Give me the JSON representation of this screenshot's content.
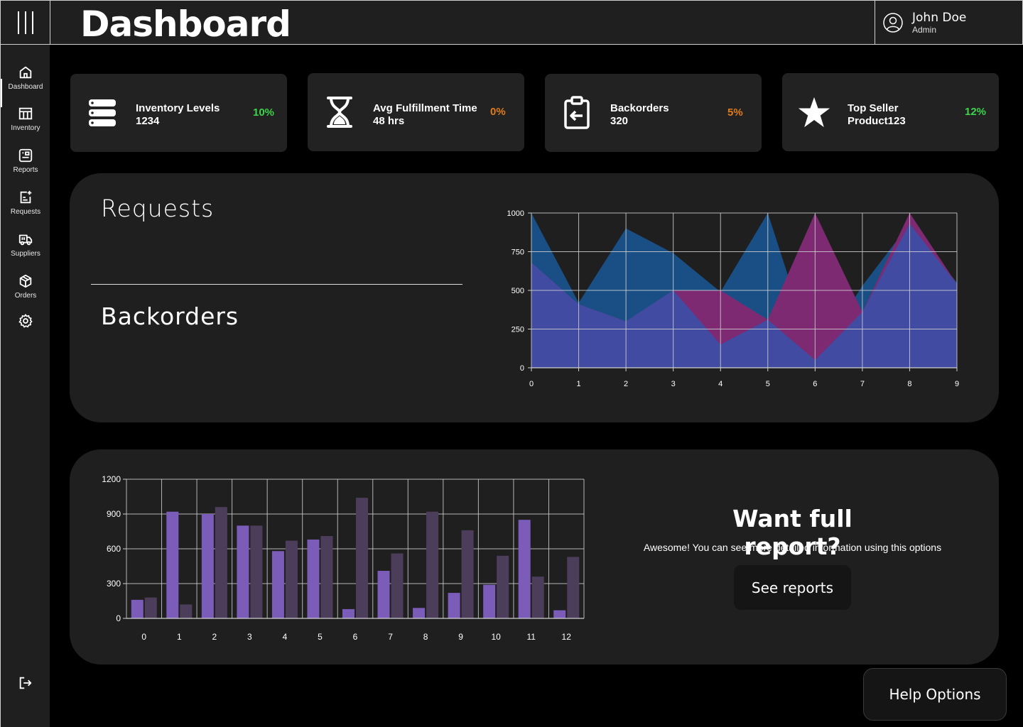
{
  "header": {
    "title": "Dashboard",
    "user_name": "John Doe",
    "user_role": "Admin"
  },
  "sidebar": {
    "items": [
      {
        "label": "Dashboard",
        "icon": "home-icon"
      },
      {
        "label": "Inventory",
        "icon": "table-icon"
      },
      {
        "label": "Reports",
        "icon": "report-icon"
      },
      {
        "label": "Requests",
        "icon": "request-icon"
      },
      {
        "label": "Suppliers",
        "icon": "truck-icon"
      },
      {
        "label": "Orders",
        "icon": "box-icon"
      }
    ],
    "settings_icon": "gear-icon",
    "logout_icon": "logout-icon"
  },
  "kpis": [
    {
      "label": "Inventory Levels",
      "value": "1234",
      "change": "10%",
      "color": "#3bd44a",
      "icon": "server-icon"
    },
    {
      "label": "Avg Fulfillment Time",
      "value": "48 hrs",
      "change": "0%",
      "color": "#e07b1a",
      "icon": "hourglass-icon"
    },
    {
      "label": "Backorders",
      "value": "320",
      "change": "5%",
      "color": "#e07b1a",
      "icon": "clipboard-icon"
    },
    {
      "label": "Top Seller",
      "value": "Product123",
      "change": "12%",
      "color": "#3bd44a",
      "icon": "star-icon"
    }
  ],
  "panels": {
    "requests_title": "Requests",
    "backorders_title": "Backorders"
  },
  "report": {
    "title": "Want full report?",
    "description": "Awesome! You can see more detailed information using this options",
    "button": "See reports"
  },
  "help_button": "Help Options",
  "chart_data": [
    {
      "type": "area",
      "x": [
        0,
        1,
        2,
        3,
        4,
        5,
        6,
        7,
        8,
        9
      ],
      "ylim": [
        0,
        1000
      ],
      "yticks": [
        0,
        250,
        500,
        750,
        1000
      ],
      "grid": true,
      "series": [
        {
          "values": [
            1000,
            420,
            900,
            740,
            490,
            1000,
            50,
            530,
            930,
            550
          ],
          "color": "#1a4f86"
        },
        {
          "values": [
            680,
            410,
            300,
            500,
            500,
            310,
            1000,
            360,
            1000,
            540
          ],
          "color": "#7e2a73"
        },
        {
          "values": [
            680,
            410,
            300,
            500,
            150,
            310,
            50,
            360,
            930,
            540
          ],
          "color": "#3e4da4"
        }
      ]
    },
    {
      "type": "bar",
      "categories": [
        "0",
        "1",
        "2",
        "3",
        "4",
        "5",
        "6",
        "7",
        "8",
        "9",
        "10",
        "11",
        "12"
      ],
      "ylim": [
        0,
        1200
      ],
      "yticks": [
        0,
        300,
        600,
        900,
        1200
      ],
      "grid": true,
      "series": [
        {
          "values": [
            160,
            920,
            900,
            800,
            580,
            680,
            80,
            410,
            90,
            220,
            290,
            850,
            70
          ],
          "color": "#7b5cb8"
        },
        {
          "values": [
            180,
            120,
            960,
            800,
            670,
            710,
            1040,
            560,
            920,
            760,
            540,
            360,
            530
          ],
          "color": "#4c3e5b"
        }
      ]
    }
  ]
}
